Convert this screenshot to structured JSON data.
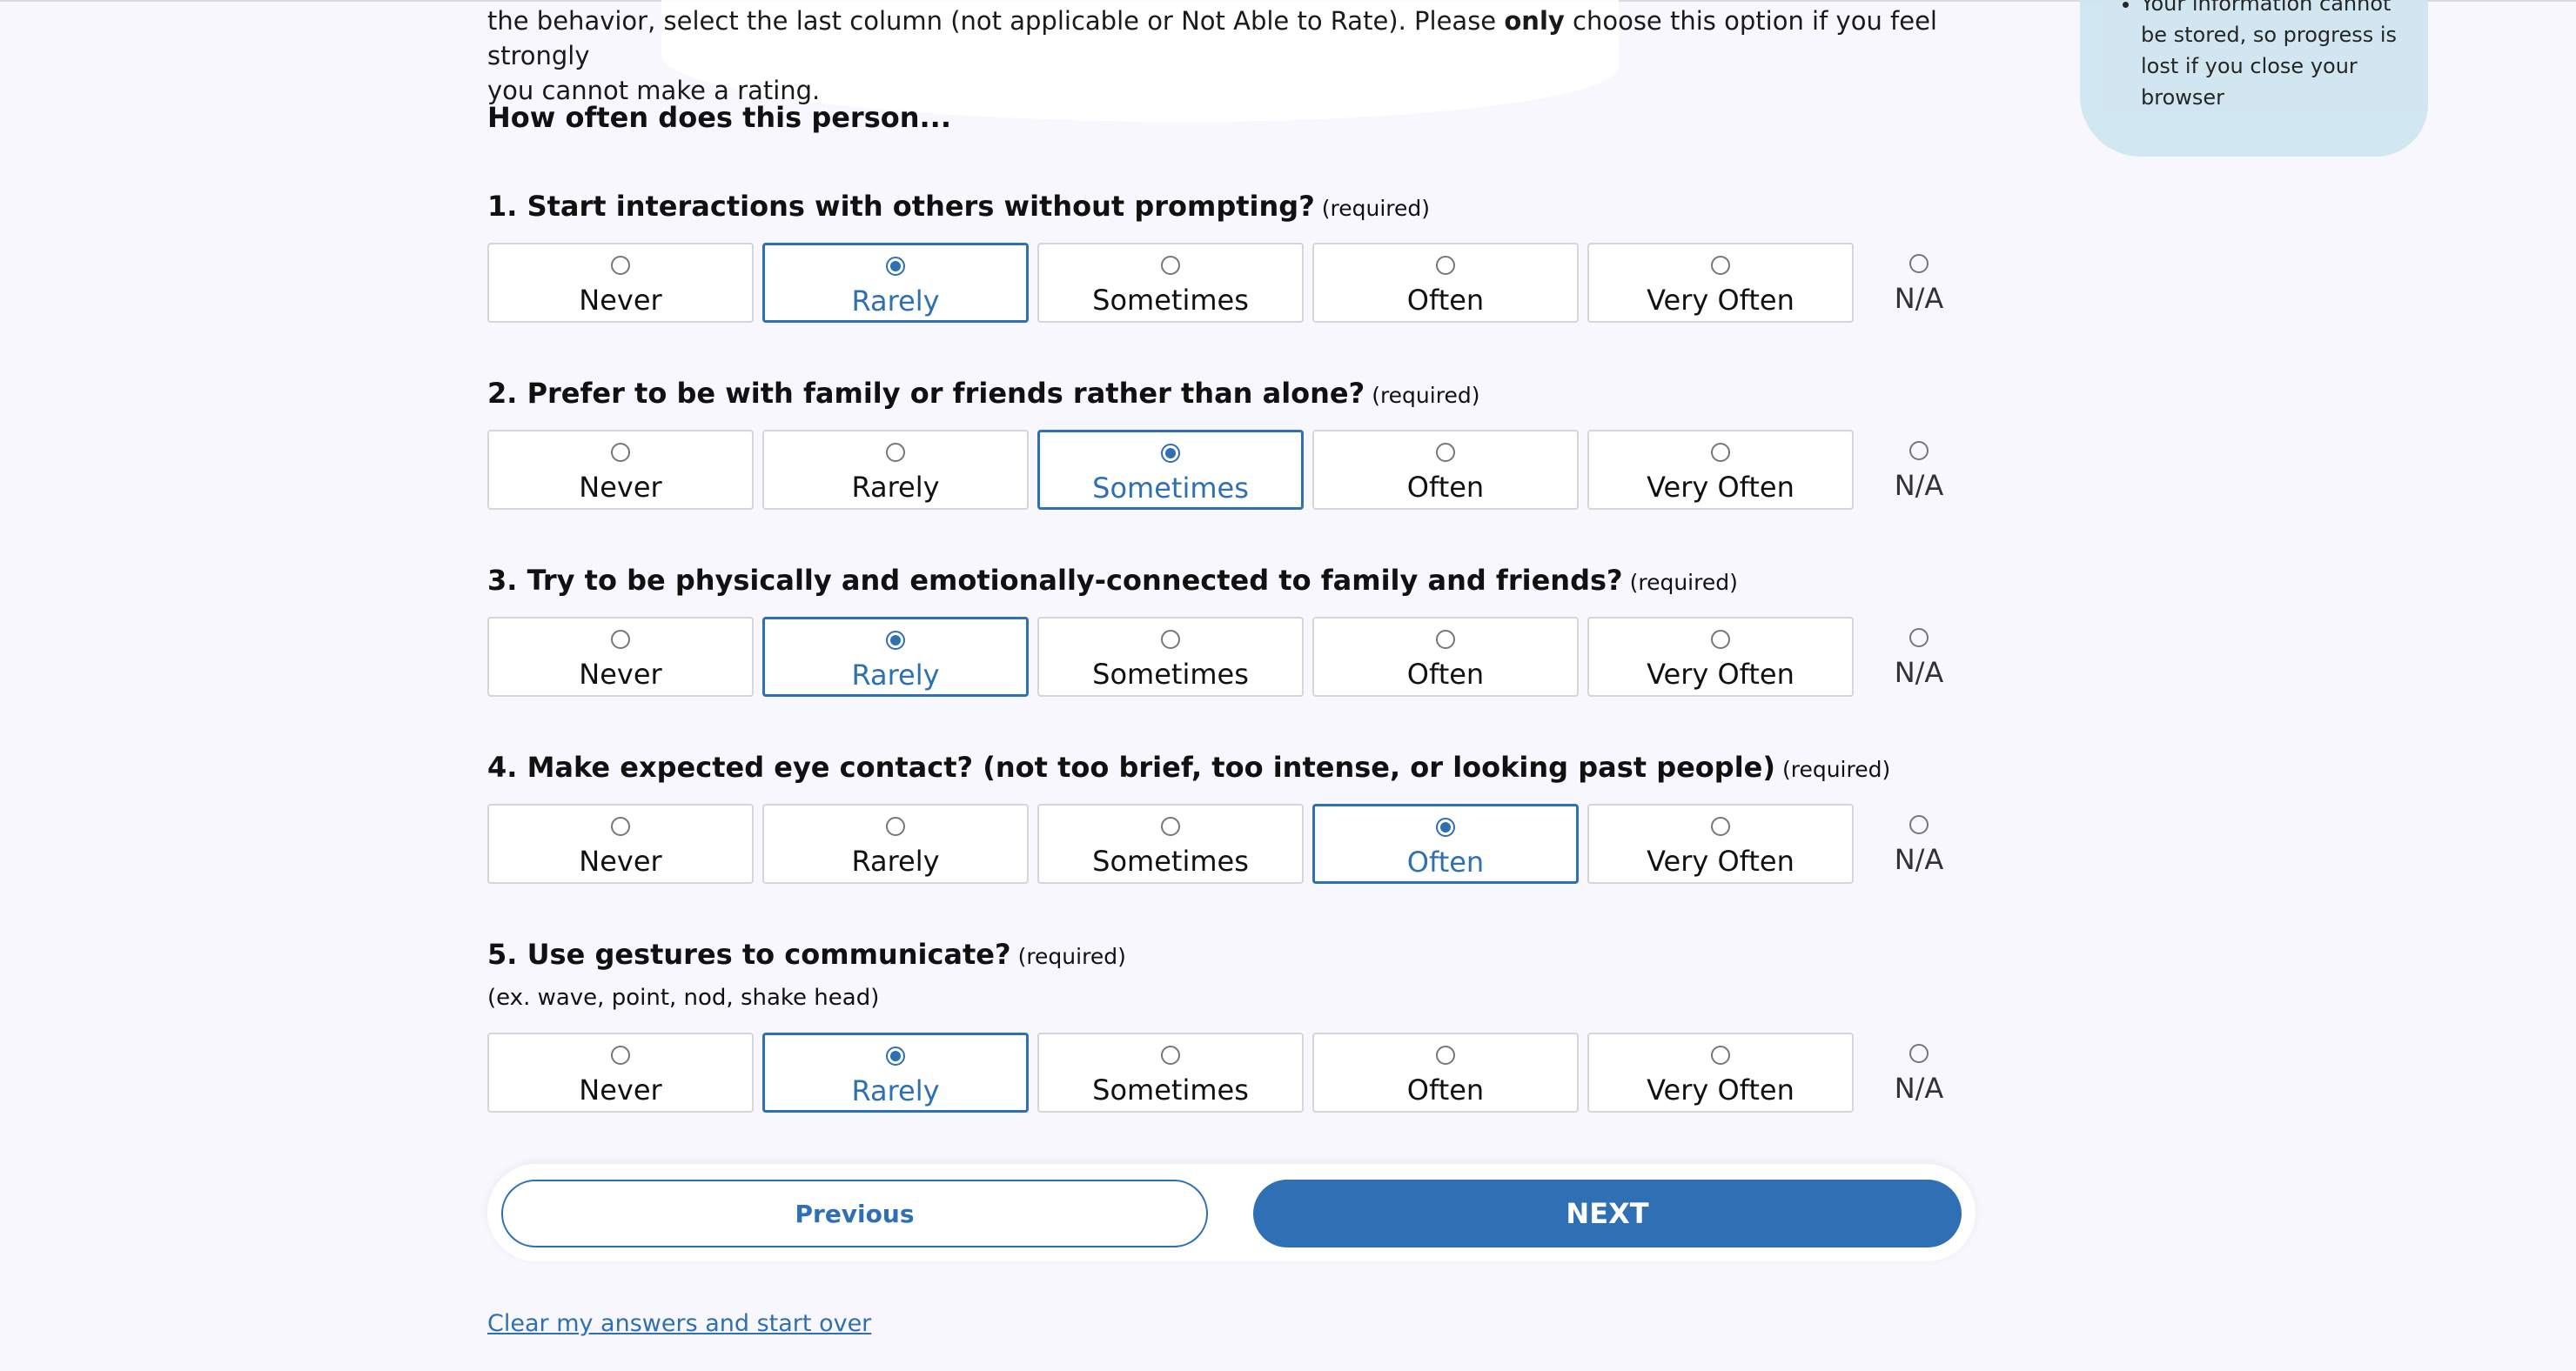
{
  "intro": {
    "line1_a": "the behavior, select the last column (not applicable or Not Able to Rate). Please ",
    "line1_bold": "only",
    "line1_b": " choose this option if you feel strongly",
    "line2": "you cannot make a rating.",
    "prompt": "How often does this person..."
  },
  "sidebar_note": "Your information cannot be stored, so progress is lost if you close your browser",
  "required_label": "(required)",
  "options": [
    "Never",
    "Rarely",
    "Sometimes",
    "Often",
    "Very Often"
  ],
  "na_label": "N/A",
  "questions": [
    {
      "title": "1. Start interactions with others without prompting?",
      "selected": "Rarely"
    },
    {
      "title": "2. Prefer to be with family or friends rather than alone?",
      "selected": "Sometimes"
    },
    {
      "title": "3. Try to be physically and emotionally-connected to family and friends?",
      "selected": "Rarely"
    },
    {
      "title": "4. Make expected eye contact? (not too brief, too intense, or looking past people)",
      "selected": "Often"
    },
    {
      "title": "5. Use gestures to communicate?",
      "subtitle": "(ex. wave, point, nod, shake head)",
      "selected": "Rarely"
    }
  ],
  "nav": {
    "previous": "Previous",
    "next": "NEXT"
  },
  "clear_link": "Clear my answers and start over",
  "colors": {
    "accent": "#2f6fb3",
    "background": "#f8f7fd",
    "sidebar": "#cfe6f0"
  }
}
